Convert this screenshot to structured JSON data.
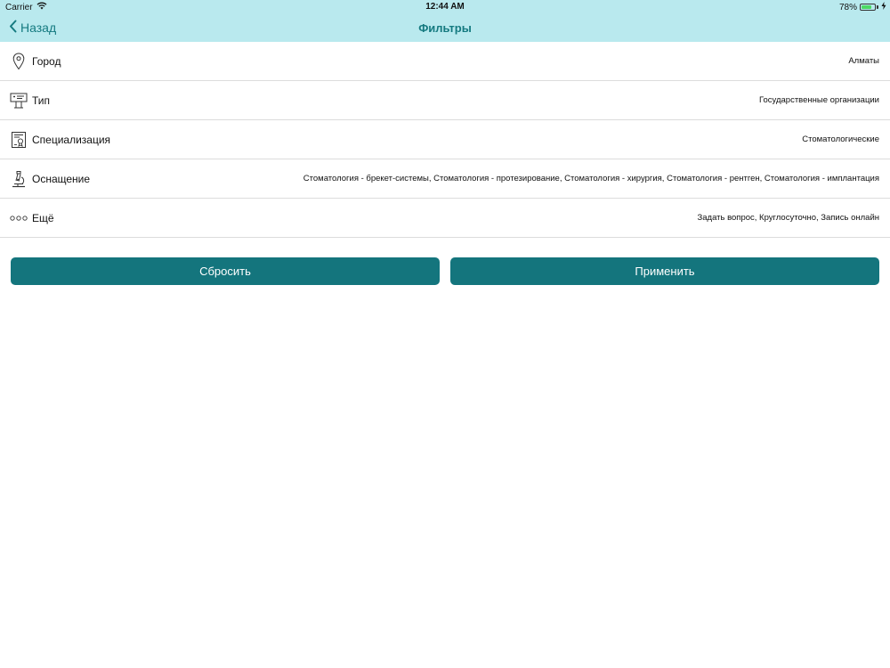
{
  "status_bar": {
    "carrier": "Carrier",
    "time": "12:44 AM",
    "battery_percent": "78%",
    "battery_level": 0.78
  },
  "nav": {
    "back_label": "Назад",
    "title": "Фильтры"
  },
  "filters": [
    {
      "icon": "location-pin-icon",
      "label": "Город",
      "value": "Алматы"
    },
    {
      "icon": "hospital-sign-icon",
      "label": "Тип",
      "value": "Государственные организации"
    },
    {
      "icon": "certificate-icon",
      "label": "Специализация",
      "value": "Стоматологические"
    },
    {
      "icon": "microscope-icon",
      "label": "Оснащение",
      "value": "Стоматология - брекет-системы, Стоматология - протезирование, Стоматология - хирургия, Стоматология - рентген, Стоматология - имплантация"
    },
    {
      "icon": "more-dots-icon",
      "label": "Ещё",
      "value": "Задать вопрос, Круглосуточно, Запись онлайн"
    }
  ],
  "actions": {
    "reset_label": "Сбросить",
    "apply_label": "Применить"
  },
  "colors": {
    "header_bg": "#b9e9ee",
    "accent": "#157a80",
    "button_bg": "#14757d"
  }
}
